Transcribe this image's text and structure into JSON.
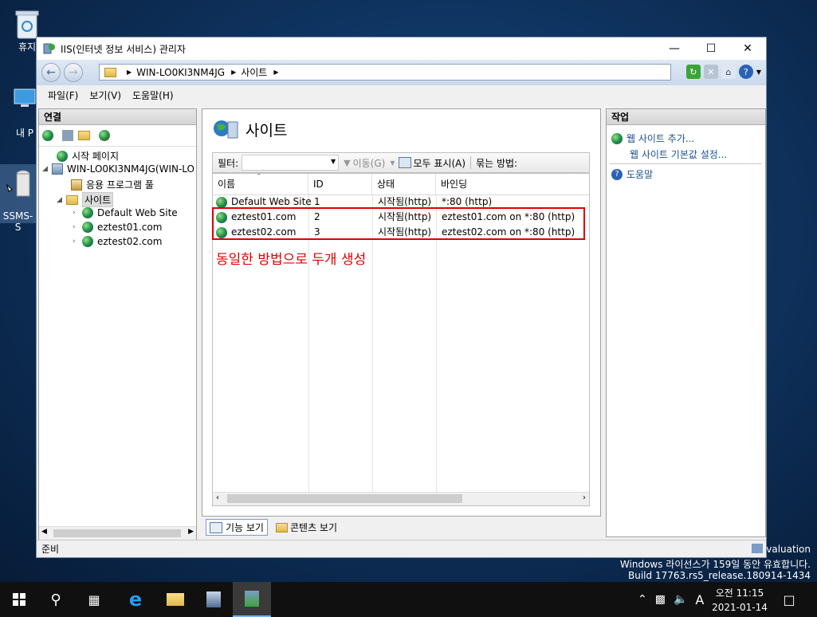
{
  "desktop": {
    "icons": [
      {
        "label": "휴지"
      },
      {
        "label": "내 P"
      },
      {
        "label": "SSMS-S"
      }
    ],
    "watermark": {
      "edition": "Evaluation",
      "license": "Windows 라이선스가 159일 동안 유효합니다.",
      "build": "Build 17763.rs5_release.180914-1434"
    }
  },
  "window": {
    "title": "IIS(인터넷 정보 서비스) 관리자",
    "controls": {
      "minimize": "—",
      "maximize": "☐",
      "close": "✕"
    },
    "address": {
      "crumbs": [
        "WIN-LO0KI3NM4JG",
        "사이트"
      ]
    },
    "menu": [
      "파일(F)",
      "보기(V)",
      "도움말(H)"
    ],
    "connections": {
      "header": "연결",
      "tree": {
        "start_page": "시작 페이지",
        "server": "WIN-LO0KI3NM4JG(WIN-LO",
        "app_pools": "응용 프로그램 풀",
        "sites": "사이트",
        "site_items": [
          "Default Web Site",
          "eztest01.com",
          "eztest02.com"
        ]
      }
    },
    "content": {
      "title": "사이트",
      "filter_label": "필터:",
      "go_label": "이동(G)",
      "show_all_label": "모두 표시(A)",
      "group_by_label": "묶는 방법:",
      "columns": [
        "이름",
        "ID",
        "상태",
        "바인딩"
      ],
      "rows": [
        {
          "name": "Default Web Site",
          "id": "1",
          "status": "시작됨(http)",
          "binding": "*:80 (http)"
        },
        {
          "name": "eztest01.com",
          "id": "2",
          "status": "시작됨(http)",
          "binding": "eztest01.com on *:80 (http)"
        },
        {
          "name": "eztest02.com",
          "id": "3",
          "status": "시작됨(http)",
          "binding": "eztest02.com on *:80 (http)"
        }
      ],
      "annotation": "동일한 방법으로 두개 생성",
      "annotation_color": "#e00000",
      "tabs": {
        "features": "기능 보기",
        "content": "콘텐츠 보기"
      }
    },
    "actions": {
      "header": "작업",
      "add_site": "웹 사이트 추가...",
      "site_defaults": "웹 사이트 기본값 설정...",
      "help": "도움말"
    },
    "status": "준비"
  },
  "taskbar": {
    "ime": "A",
    "time": "오전 11:15",
    "date": "2021-01-14"
  }
}
